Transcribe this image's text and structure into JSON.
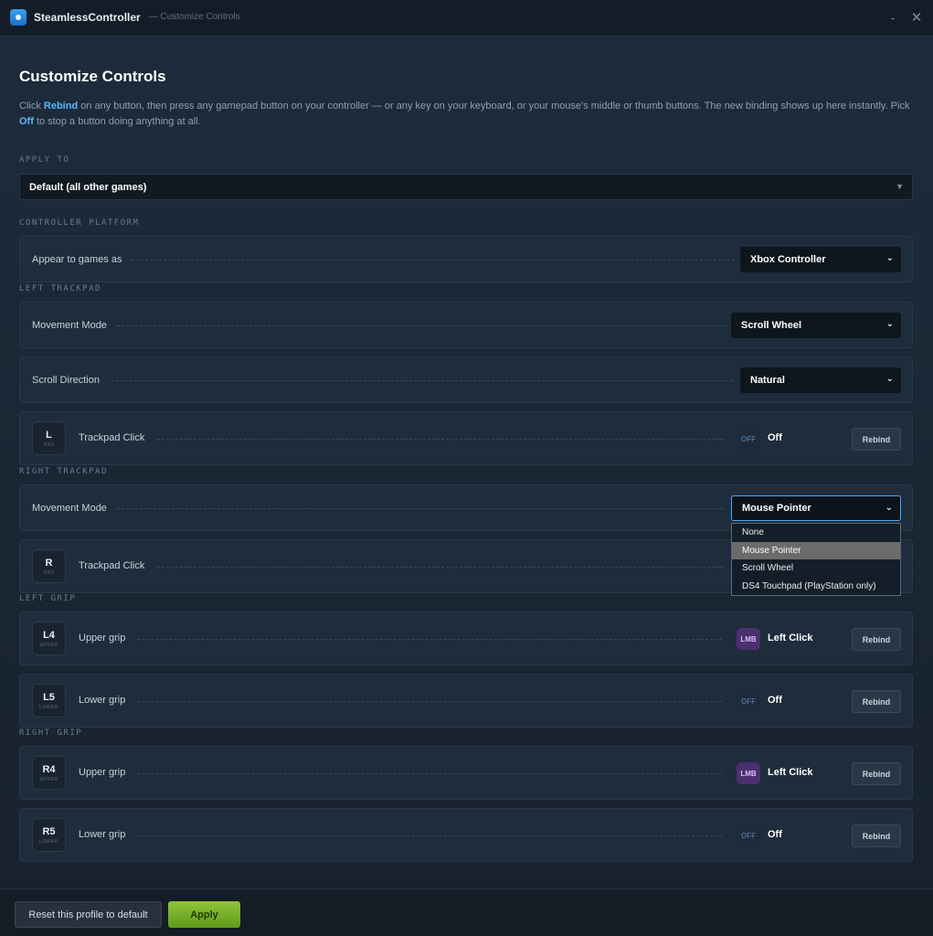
{
  "titlebar": {
    "app_name": "SteamlessController",
    "subtitle": "— Customize Controls",
    "minimize_glyph": "-",
    "close_glyph": "✕"
  },
  "page": {
    "title": "Customize Controls",
    "intro_1": "Click ",
    "intro_rebind": "Rebind",
    "intro_2": " on any button, then press any gamepad button on your controller — or any key on your keyboard, or your mouse's middle or thumb buttons. The new binding shows up here instantly. Pick ",
    "intro_off": "Off",
    "intro_3": " to stop a button doing anything at all."
  },
  "apply_to": {
    "label": "APPLY TO",
    "value": "Default (all other games)"
  },
  "controller_platform": {
    "label": "CONTROLLER PLATFORM",
    "row_label": "Appear to games as",
    "value": "Xbox Controller"
  },
  "left_trackpad": {
    "label": "LEFT TRACKPAD",
    "movement_label": "Movement Mode",
    "movement_value": "Scroll Wheel",
    "scroll_label": "Scroll Direction",
    "scroll_value": "Natural",
    "click": {
      "key": "L",
      "sub": "PAD",
      "label": "Trackpad Click",
      "chip": "OFF",
      "value": "Off",
      "rebind": "Rebind"
    }
  },
  "right_trackpad": {
    "label": "RIGHT TRACKPAD",
    "movement_label": "Movement Mode",
    "movement_value": "Mouse Pointer",
    "click": {
      "key": "R",
      "sub": "PAD",
      "label": "Trackpad Click"
    }
  },
  "dropdown": {
    "options": [
      "None",
      "Mouse Pointer",
      "Scroll Wheel",
      "DS4 Touchpad (PlayStation only)"
    ],
    "selected": "Mouse Pointer"
  },
  "left_grip": {
    "label": "LEFT GRIP",
    "upper": {
      "key": "L4",
      "sub": "UPPER",
      "label": "Upper grip",
      "chip": "LMB",
      "value": "Left Click",
      "rebind": "Rebind"
    },
    "lower": {
      "key": "L5",
      "sub": "LOWER",
      "label": "Lower grip",
      "chip": "OFF",
      "value": "Off",
      "rebind": "Rebind"
    }
  },
  "right_grip": {
    "label": "RIGHT GRIP",
    "upper": {
      "key": "R4",
      "sub": "UPPER",
      "label": "Upper grip",
      "chip": "LMB",
      "value": "Left Click",
      "rebind": "Rebind"
    },
    "lower": {
      "key": "R5",
      "sub": "LOWER",
      "label": "Lower grip",
      "chip": "OFF",
      "value": "Off",
      "rebind": "Rebind"
    }
  },
  "footer": {
    "reset_label": "Reset this profile to default",
    "apply_label": "Apply"
  },
  "colors": {
    "background": "#1b2838",
    "card": "#1f2c3b",
    "accent_link": "#5ab8ff",
    "apply_green": "#7cb82f",
    "lmb_chip": "#4c2f70"
  },
  "icons": {
    "app": "app-logo-icon",
    "select_caret": "caret-down-icon",
    "chevron": "chevron-down-icon"
  }
}
